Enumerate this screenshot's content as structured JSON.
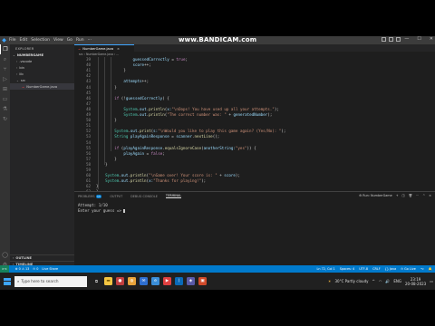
{
  "titlebar": {
    "menu": [
      "File",
      "Edit",
      "Selection",
      "View",
      "Go",
      "Run",
      "···"
    ],
    "watermark": "www.BANDICAM.com"
  },
  "sidebar": {
    "header": "EXPLORER",
    "section": "NUMBERGAME",
    "items": [
      {
        "label": ".vscode",
        "depth": 1,
        "chevron": "›"
      },
      {
        "label": "bin",
        "depth": 1,
        "chevron": "›"
      },
      {
        "label": "lib",
        "depth": 1,
        "chevron": "›"
      },
      {
        "label": "src",
        "depth": 1,
        "chevron": "⌄"
      },
      {
        "label": "NumberGame.java",
        "depth": 2,
        "selected": true
      }
    ],
    "footer": [
      "OUTLINE",
      "TIMELINE",
      "JAVA PROJECTS"
    ]
  },
  "editor": {
    "tab_label": "NumberGame.java",
    "tab_close": "×",
    "breadcrumb": "src › NumberGame.java › ..."
  },
  "code_lines": [
    {
      "n": "39",
      "indent": 16,
      "html": "<span class=\"var\">guessedCorrectly</span> = <span class=\"kw\">true</span>;"
    },
    {
      "n": "40",
      "indent": 16,
      "html": "<span class=\"var\">score</span>++;"
    },
    {
      "n": "41",
      "indent": 12,
      "html": "}"
    },
    {
      "n": "42",
      "indent": 0,
      "html": ""
    },
    {
      "n": "43",
      "indent": 12,
      "html": "<span class=\"var\">attempts</span>++;"
    },
    {
      "n": "44",
      "indent": 8,
      "html": "}"
    },
    {
      "n": "45",
      "indent": 0,
      "html": ""
    },
    {
      "n": "46",
      "indent": 8,
      "html": "<span class=\"kw\">if</span> (!<span class=\"var\">guessedCorrectly</span>) {"
    },
    {
      "n": "47",
      "indent": 0,
      "html": ""
    },
    {
      "n": "48",
      "indent": 12,
      "html": "<span class=\"ty\">System</span>.<span class=\"var\">out</span>.<span class=\"fn\">println</span>(<span class=\"var\">x:</span><span class=\"str\">\"\\nOops! You have used up all your attempts.\"</span>);"
    },
    {
      "n": "49",
      "indent": 12,
      "html": "<span class=\"ty\">System</span>.<span class=\"var\">out</span>.<span class=\"fn\">println</span>(<span class=\"str\">\"The correct number was: \"</span> + <span class=\"var\">generatedNumber</span>);"
    },
    {
      "n": "50",
      "indent": 8,
      "html": "}"
    },
    {
      "n": "51",
      "indent": 0,
      "html": ""
    },
    {
      "n": "52",
      "indent": 8,
      "html": "<span class=\"ty\">System</span>.<span class=\"var\">out</span>.<span class=\"fn\">print</span>(<span class=\"var\">s:</span><span class=\"str\">\"\\nWould you like to play this game again? (Yes/No): \"</span>);"
    },
    {
      "n": "53",
      "indent": 8,
      "html": "<span class=\"ty\">String</span> <span class=\"var\">playAgainResponse</span> = <span class=\"var\">scanner</span>.<span class=\"fn\">nextLine</span>();"
    },
    {
      "n": "54",
      "indent": 0,
      "html": ""
    },
    {
      "n": "55",
      "indent": 8,
      "html": "<span class=\"kw\">if</span> (<span class=\"var\">playAgainResponse</span>.<span class=\"fn\">equalsIgnoreCase</span>(<span class=\"var\">anotherString:</span><span class=\"str\">\"yes\"</span>)) {"
    },
    {
      "n": "56",
      "indent": 12,
      "html": "<span class=\"var\">playAgain</span> = <span class=\"kw\">false</span>;"
    },
    {
      "n": "57",
      "indent": 8,
      "html": "}"
    },
    {
      "n": "58",
      "indent": 4,
      "html": "}"
    },
    {
      "n": "59",
      "indent": 0,
      "html": ""
    },
    {
      "n": "60",
      "indent": 4,
      "html": "<span class=\"ty\">System</span>.<span class=\"var\">out</span>.<span class=\"fn\">println</span>(<span class=\"str\">\"\\nGame over! Your score is: \"</span> + <span class=\"var\">score</span>);"
    },
    {
      "n": "61",
      "indent": 4,
      "html": "<span class=\"ty\">System</span>.<span class=\"var\">out</span>.<span class=\"fn\">println</span>(<span class=\"var\">x:</span><span class=\"str\">\"Thanks for playing!\"</span>);"
    },
    {
      "n": "62",
      "indent": 0,
      "html": "}"
    },
    {
      "n": "63",
      "indent": 0,
      "html": "}"
    },
    {
      "n": "64",
      "indent": 0,
      "html": ""
    }
  ],
  "panel": {
    "tabs": [
      "PROBLEMS",
      "OUTPUT",
      "DEBUG CONSOLE",
      "TERMINAL"
    ],
    "problems_badge": "13",
    "active_tab": "TERMINAL",
    "run_label": "Run: NumberGame",
    "terminal_lines": [
      "Attempt: 1/10",
      "Enter your guess => "
    ]
  },
  "status": {
    "remote": "><",
    "left": [
      "⊗ 0 ⚠ 13",
      "⊙ 0",
      "Live Share"
    ],
    "right": [
      "Ln 72, Col 1",
      "Spaces: 4",
      "UTF-8",
      "CRLF",
      "{} Java",
      "⊙ Go Live",
      "⌥",
      "🔔"
    ]
  },
  "taskbar": {
    "search_placeholder": "Type here to search",
    "weather": "30°C  Partly cloudy",
    "lang": "ENG",
    "time": "23:19",
    "date": "20-08-2023"
  },
  "colors": {
    "accent": "#007acc",
    "editor_bg": "#1e1e1e",
    "sidebar_bg": "#252526"
  }
}
